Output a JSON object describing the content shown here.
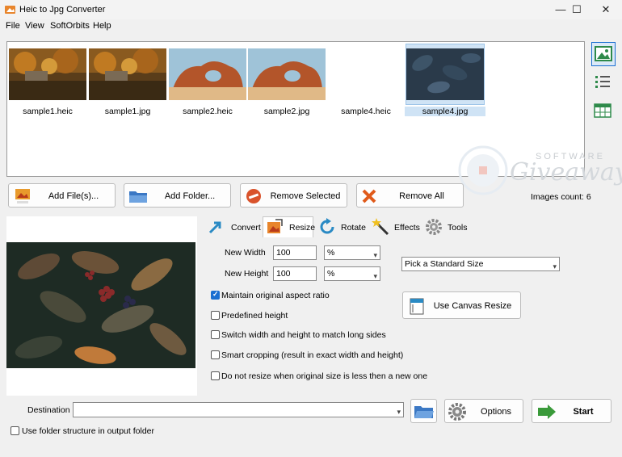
{
  "window": {
    "title": "Heic to Jpg Converter",
    "minimize_glyph": "—",
    "maximize_glyph": "☐",
    "close_glyph": "✕"
  },
  "menu": [
    "File",
    "View",
    "SoftOrbits",
    "Help"
  ],
  "images": [
    {
      "name": "sample1.heic",
      "kind": "autumn-lake"
    },
    {
      "name": "sample1.jpg",
      "kind": "autumn-lake"
    },
    {
      "name": "sample2.heic",
      "kind": "desert-arch"
    },
    {
      "name": "sample2.jpg",
      "kind": "desert-arch"
    },
    {
      "name": "sample4.heic",
      "kind": "blank"
    },
    {
      "name": "sample4.jpg",
      "kind": "leaves-selected"
    }
  ],
  "watermark": {
    "top": "SOFTWARE",
    "main": "Giveaway"
  },
  "toolbar": {
    "add_files": "Add File(s)...",
    "add_folder": "Add Folder...",
    "remove_selected": "Remove Selected",
    "remove_all": "Remove All",
    "images_count": "Images count: 6"
  },
  "tabs": [
    "Convert",
    "Resize",
    "Rotate",
    "Effects",
    "Tools"
  ],
  "active_tab": "Resize",
  "resize": {
    "width_label": "New Width",
    "width_value": "100",
    "width_unit": "%",
    "height_label": "New Height",
    "height_value": "100",
    "height_unit": "%",
    "standard_size": "Pick a Standard Size",
    "canvas_button": "Use Canvas Resize",
    "options": [
      {
        "label": "Maintain original aspect ratio",
        "checked": true
      },
      {
        "label": "Predefined height",
        "checked": false
      },
      {
        "label": "Switch width and height to match long sides",
        "checked": false
      },
      {
        "label": "Smart cropping (result in exact width and height)",
        "checked": false
      },
      {
        "label": "Do not resize when original size is less then a new one",
        "checked": false
      }
    ]
  },
  "bottom": {
    "destination_label": "Destination",
    "destination_value": "",
    "options_label": "Options",
    "start_label": "Start",
    "folder_structure_label": "Use folder structure in output folder"
  },
  "colors": {
    "accent": "#1a6fd1",
    "start_arrow": "#3a9a3a",
    "remove_all_x": "#e05a1a",
    "remove_selected": "#d9532c"
  }
}
